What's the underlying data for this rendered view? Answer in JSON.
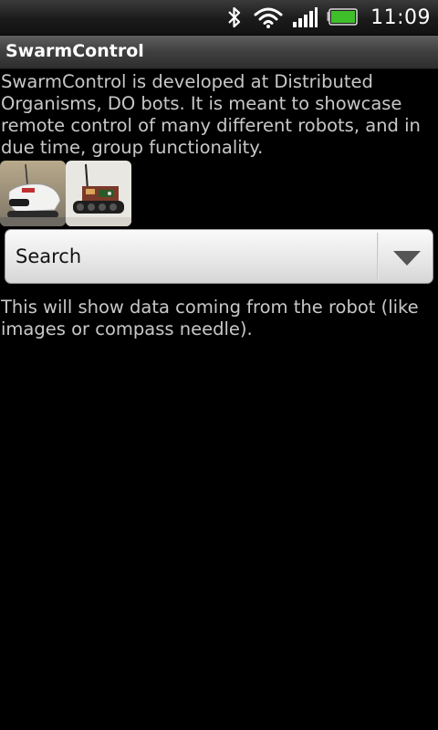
{
  "status_bar": {
    "time": "11:09",
    "icons": [
      "bluetooth-icon",
      "wifi-icon",
      "signal-icon",
      "battery-icon"
    ],
    "battery_color": "#3fbf2a"
  },
  "app": {
    "title": "SwarmControl"
  },
  "content": {
    "description": "SwarmControl is developed at Distributed Organisms, DO bots. It is meant to showcase remote control of many different robots, and in due time, group functionality.",
    "robot_images": [
      "robot-photo-white-rover",
      "robot-photo-tracked-bot"
    ],
    "spinner": {
      "selected": "Search"
    },
    "output_text": "This will show data coming from the robot (like images or compass needle)."
  }
}
